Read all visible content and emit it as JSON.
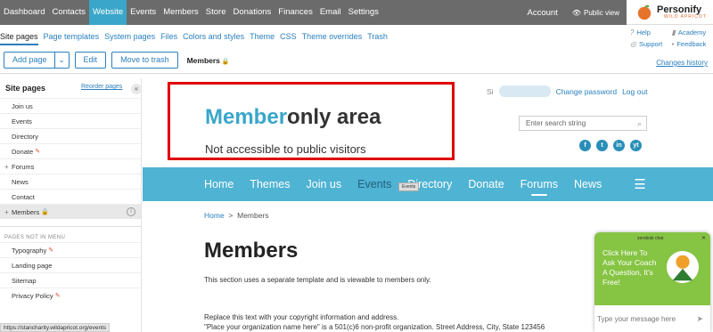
{
  "topnav": {
    "items": [
      "Dashboard",
      "Contacts",
      "Website",
      "Events",
      "Members",
      "Store",
      "Donations",
      "Finances",
      "Email",
      "Settings"
    ],
    "account": "Account",
    "public_view": "Public view"
  },
  "logo": {
    "name": "Personify",
    "tagline": "WILD APRICOT"
  },
  "subnav": {
    "items": [
      "Site pages",
      "Page templates",
      "System pages",
      "Files",
      "Colors and styles",
      "Theme",
      "CSS",
      "Theme overrides",
      "Trash"
    ]
  },
  "help": {
    "help": "Help",
    "academy": "Academy",
    "support": "Support",
    "feedback": "Feedback"
  },
  "toolbar": {
    "add_page": "Add page",
    "edit": "Edit",
    "move_to_trash": "Move to trash",
    "current_page": "Members"
  },
  "changes_history": "Changes history",
  "sidebar": {
    "title": "Site pages",
    "reorder": "Reorder pages",
    "pages": [
      "Join us",
      "Events",
      "Directory",
      "Donate",
      "Forums",
      "News",
      "Contact",
      "Members"
    ],
    "section_title": "PAGES NOT IN MENU",
    "hidden_pages": [
      "Typography",
      "Landing page",
      "Sitemap",
      "Privacy Policy"
    ]
  },
  "status_url": "https://stancharity.wildapricot.org/events",
  "preview": {
    "signin_prefix": "Si",
    "change_password": "Change password",
    "logout": "Log out",
    "title_accent": "Member",
    "title_rest": "only area",
    "subtitle": "Not accessible to public visitors",
    "search_placeholder": "Enter search string",
    "social": [
      "f",
      "t",
      "in",
      "yt"
    ],
    "nav": [
      "Home",
      "Themes",
      "Join us",
      "Events",
      "Directory",
      "Donate",
      "Forums",
      "News"
    ],
    "tooltip": "Events",
    "breadcrumb": {
      "home": "Home",
      "sep": ">",
      "current": "Members"
    },
    "heading": "Members",
    "body": "This section uses a separate template and is viewable to members only.",
    "footer_line1": "Replace this text with your copyright information and address.",
    "footer_line2": "\"Place your organization name here\" is a 501(c)6 non-profit organization. Street Address, City, State 123456"
  },
  "chat": {
    "brand": "zendesk chat",
    "message": "Click Here To Ask Your Coach A Question, It's Free!",
    "placeholder": "Type your message here"
  },
  "colors": {
    "accent": "#3aa6c9",
    "topnav": "#6b6b6b",
    "nav": "#4fb3d3",
    "chat": "#86c443",
    "highlight": "#e00000"
  }
}
